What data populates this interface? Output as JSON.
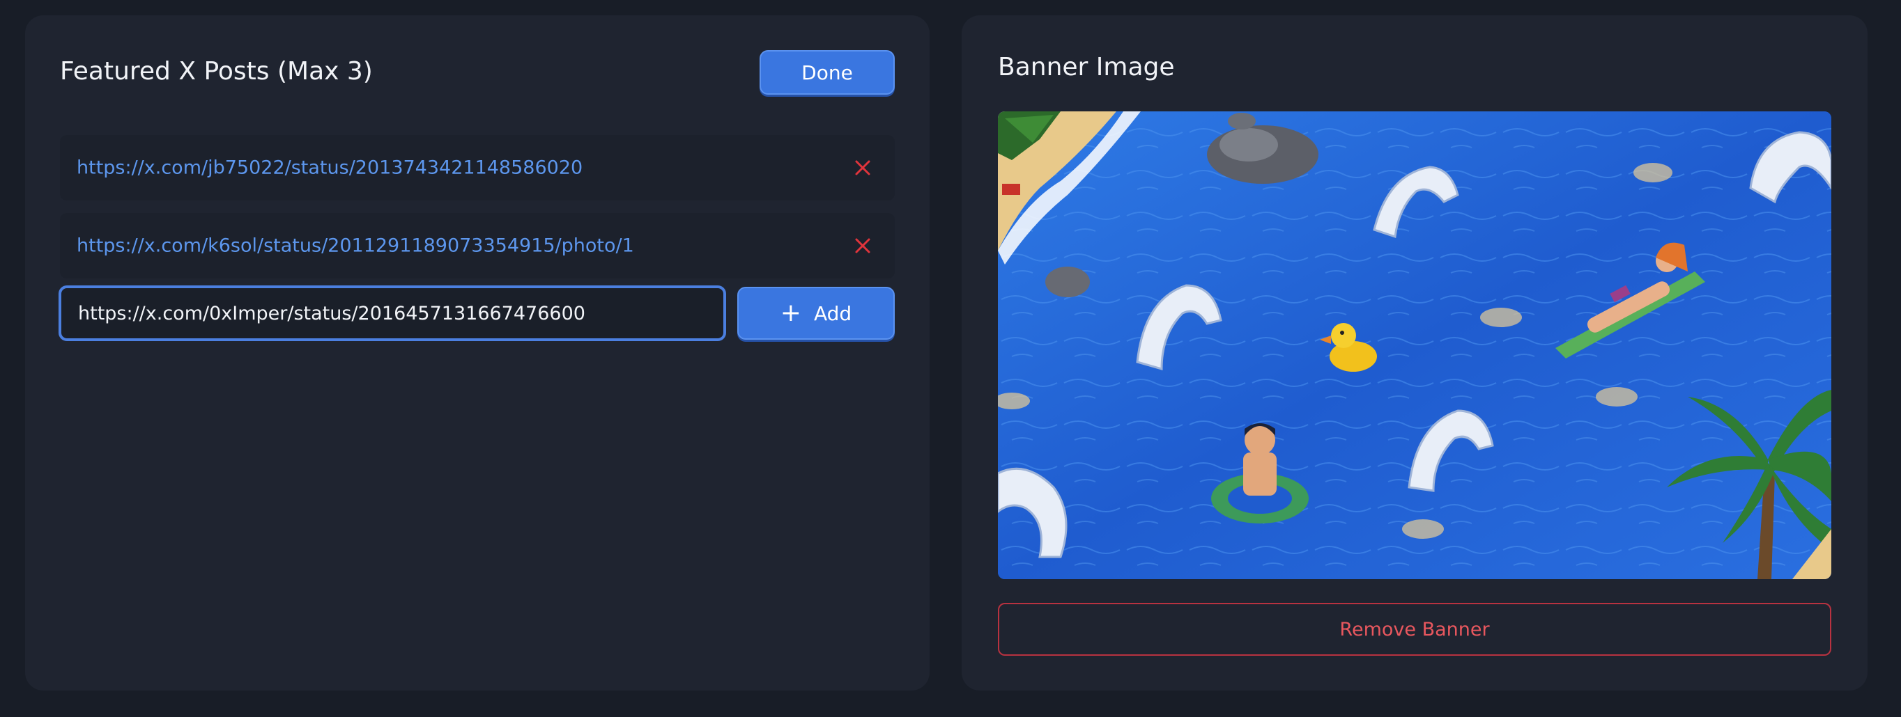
{
  "featured_posts": {
    "title": "Featured X Posts (Max 3)",
    "done_label": "Done",
    "posts": [
      {
        "url": "https://x.com/jb75022/status/2013743421148586020",
        "remove_icon": "close-icon"
      },
      {
        "url": "https://x.com/k6sol/status/2011291189073354915/photo/1",
        "remove_icon": "close-icon"
      }
    ],
    "input": {
      "value": "https://x.com/0xImper/status/2016457131667476600",
      "placeholder": ""
    },
    "add_label": "Add",
    "add_icon": "plus-icon"
  },
  "banner": {
    "title": "Banner Image",
    "image_alt": "Pixel-art beach scene: swimmer in ring, rubber duck, girl on float, sea serpents, palm tree",
    "remove_label": "Remove Banner"
  },
  "colors": {
    "page_bg": "#181d27",
    "panel_bg": "#1f2430",
    "accent": "#3a76e0",
    "link": "#5d97ee",
    "danger": "#e8575e",
    "danger_icon": "#e0343c"
  }
}
